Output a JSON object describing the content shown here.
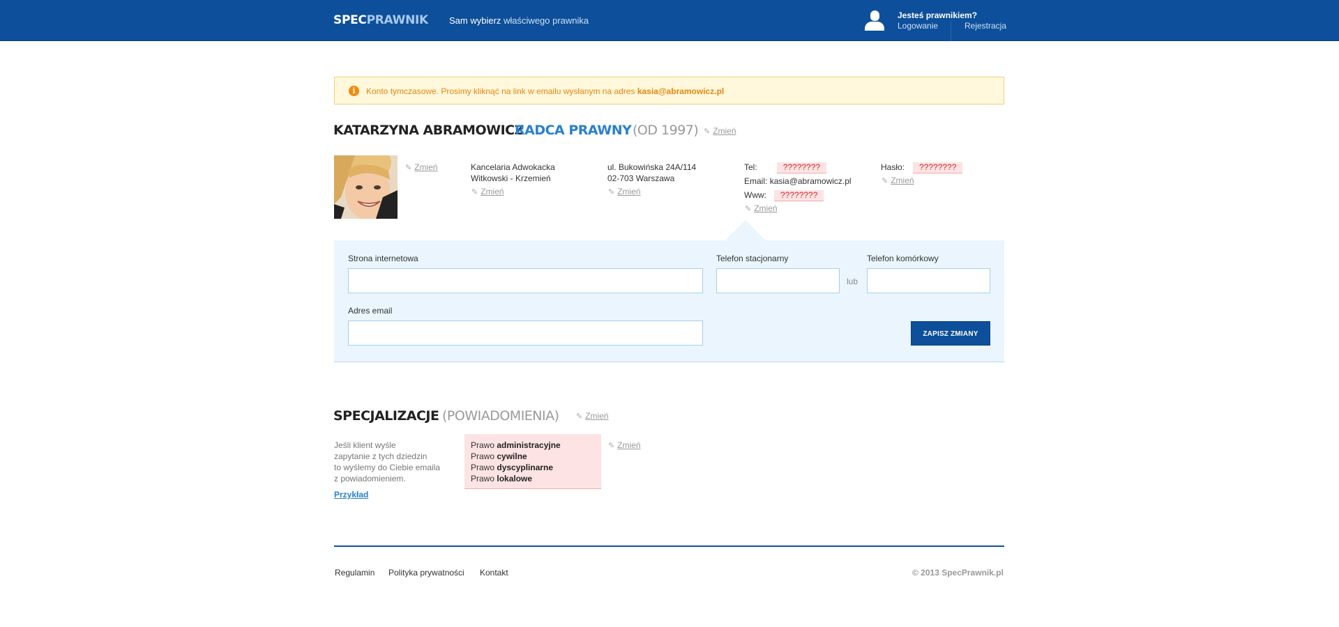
{
  "header": {
    "logo_part1": "SPEC",
    "logo_part2": "PRAWNIK",
    "tagline_bold": "Sam wybierz",
    "tagline_rest": " właściwego prawnika",
    "lawyer_question": "Jesteś prawnikiem?",
    "login": "Logowanie",
    "register": "Rejestracja"
  },
  "alert": {
    "icon": "i",
    "text": "Konto tymczasowe. Prosimy kliknąć na link w emailu wysłanym na adres ",
    "email": "kasia@abramowicz.pl"
  },
  "profile": {
    "name": "KATARZYNA ABRAMOWICZ",
    "title": "RADCA PRAWNY",
    "since": "(OD 1997)",
    "edit_label": "Zmień",
    "firm_line1": "Kancelaria Adwokacka",
    "firm_line2": "Witkowski - Krzemień",
    "address_line1": "ul. Bukowińska 24A/114",
    "address_line2": "02-703 Warszawa",
    "tel_label": "Tel:",
    "tel_value": "????????",
    "email_label": "Email:",
    "email_value": "kasia@abramowicz.pl",
    "www_label": "Www:",
    "www_value": "????????",
    "password_label": "Hasło:",
    "password_value": "????????"
  },
  "edit_form": {
    "website_label": "Strona internetowa",
    "landline_label": "Telefon stacjonarny",
    "or_label": "lub",
    "mobile_label": "Telefon komórkowy",
    "email_label": "Adres email",
    "save_button": "ZAPISZ ZMIANY",
    "website_value": "",
    "landline_value": "",
    "mobile_value": "",
    "email_value": ""
  },
  "specializations": {
    "heading": "SPECJALIZACJE",
    "subheading": "(POWIADOMIENIA)",
    "edit_label": "Zmień",
    "description_lines": [
      "Jeśli klient wyśle",
      "zapytanie z tych dziedzin",
      "to wyślemy do Ciebie emaila",
      "z powiadomieniem."
    ],
    "example_link": "Przykład",
    "items": [
      {
        "prefix": "Prawo ",
        "name": "administracyjne"
      },
      {
        "prefix": "Prawo ",
        "name": "cywilne"
      },
      {
        "prefix": "Prawo ",
        "name": "dyscyplinarne"
      },
      {
        "prefix": "Prawo ",
        "name": "lokalowe"
      }
    ]
  },
  "footer": {
    "links": [
      "Regulamin",
      "Polityka prywatności",
      "Kontakt"
    ],
    "copyright": "© 2013 SpecPrawnik.pl"
  },
  "colors": {
    "brand_blue": "#0d4f9a",
    "accent_blue": "#2a80cc",
    "warning_orange": "#e8870e",
    "missing_red": "#d9262c",
    "panel_bg": "#eaf5fd"
  }
}
